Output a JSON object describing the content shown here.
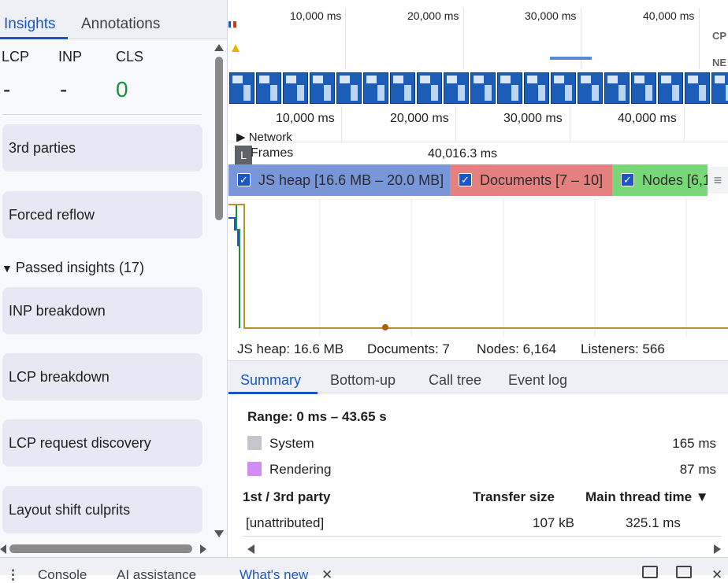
{
  "left_panel": {
    "tabs": [
      {
        "label": "Insights",
        "active": true
      },
      {
        "label": "Annotations",
        "active": false
      }
    ],
    "metrics": [
      {
        "label": "LCP",
        "value": "-"
      },
      {
        "label": "INP",
        "value": "-"
      },
      {
        "label": "CLS",
        "value": "0",
        "color": "#1e8e3e"
      }
    ],
    "insight_cards": [
      "3rd parties",
      "Forced reflow"
    ],
    "passed_insights": {
      "label": "Passed insights (17)",
      "expanded": true,
      "items": [
        "INP breakdown",
        "LCP breakdown",
        "LCP request discovery",
        "Layout shift culprits"
      ]
    }
  },
  "overview": {
    "ticks": [
      "10,000 ms",
      "20,000 ms",
      "30,000 ms",
      "40,000 ms"
    ],
    "track_labels": [
      "CP",
      "NE"
    ]
  },
  "main_ruler": {
    "ticks": [
      "10,000 ms",
      "20,000 ms",
      "30,000 ms",
      "40,000 ms"
    ]
  },
  "tracks": {
    "network_label": "Network",
    "frames_label": "Frames",
    "frames_value": "40,016.3 ms"
  },
  "memory_counters": [
    {
      "label": "JS heap [16.6 MB – 20.0 MB]",
      "checked": true,
      "bg": "#7896d8"
    },
    {
      "label": "Documents [7 – 10]",
      "checked": true,
      "bg": "#e48080"
    },
    {
      "label": "Nodes [6,1",
      "checked": true,
      "bg": "#78d878"
    }
  ],
  "memory_legend": [
    {
      "label": "JS heap: 16.6 MB",
      "color": "#1a57c6"
    },
    {
      "label": "Documents: 7",
      "color": "#c5221f"
    },
    {
      "label": "Nodes: 6,164",
      "color": "#1e8e3e"
    },
    {
      "label": "Listeners: 566",
      "color": "#b06000"
    }
  ],
  "detail_tabs": [
    {
      "label": "Summary",
      "active": true
    },
    {
      "label": "Bottom-up",
      "active": false
    },
    {
      "label": "Call tree",
      "active": false
    },
    {
      "label": "Event log",
      "active": false
    }
  ],
  "summary": {
    "range": "Range: 0 ms – 43.65 s",
    "categories": [
      {
        "name": "System",
        "value": "165 ms",
        "color": "#c4c6cc"
      },
      {
        "name": "Rendering",
        "value": "87 ms",
        "color": "#d08df4"
      }
    ],
    "table": {
      "headers": [
        "1st / 3rd party",
        "Transfer size",
        "Main thread time ▼"
      ],
      "rows": [
        [
          "[unattributed]",
          "107 kB",
          "325.1 ms"
        ]
      ]
    }
  },
  "drawer": {
    "menu_icon": "⋮",
    "tabs": [
      {
        "label": "Console",
        "active": false
      },
      {
        "label": "AI assistance",
        "active": false
      },
      {
        "label": "What's new",
        "active": true
      }
    ],
    "close_glyph": "✕"
  }
}
